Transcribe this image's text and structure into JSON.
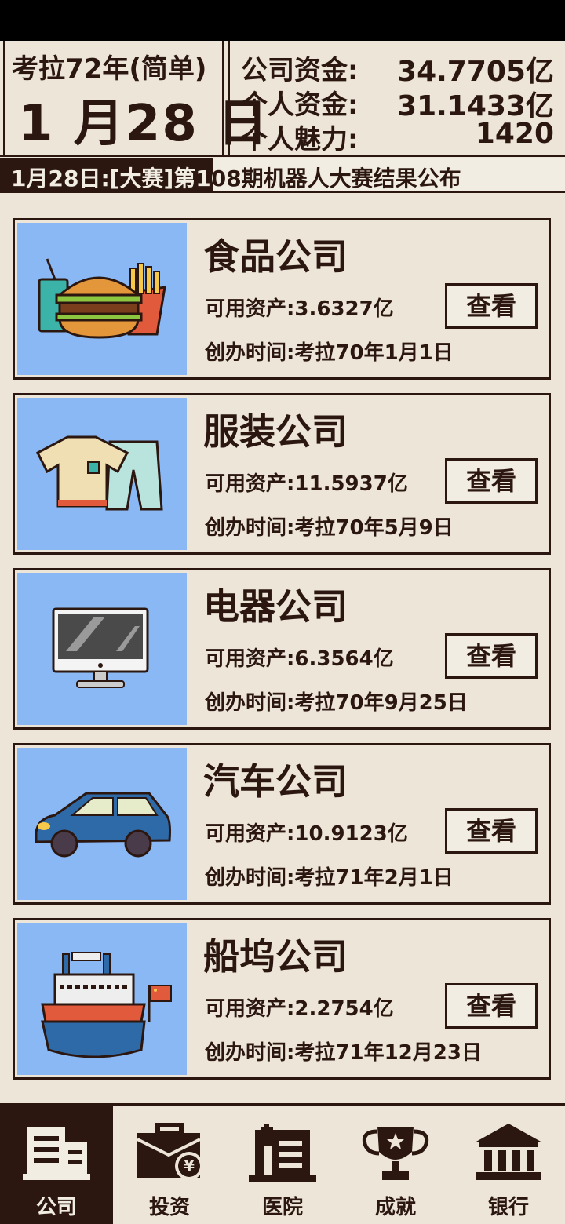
{
  "header": {
    "year": "考拉72年(简单)",
    "date": "1 月28 日",
    "funds": [
      {
        "label": "公司资金:",
        "value": "34.7705亿"
      },
      {
        "label": "个人资金:",
        "value": "31.1433亿"
      },
      {
        "label": "个人魅力:",
        "value": "1420"
      }
    ]
  },
  "news": {
    "text": "1月28日:[大赛]第108期机器人大赛结果公布"
  },
  "companies": [
    {
      "name": "食品公司",
      "assets": "可用资产:3.6327亿",
      "founded": "创办时间:考拉70年1月1日",
      "view": "查看",
      "icon": "food-icon"
    },
    {
      "name": "服装公司",
      "assets": "可用资产:11.5937亿",
      "founded": "创办时间:考拉70年5月9日",
      "view": "查看",
      "icon": "clothing-icon"
    },
    {
      "name": "电器公司",
      "assets": "可用资产:6.3564亿",
      "founded": "创办时间:考拉70年9月25日",
      "view": "查看",
      "icon": "monitor-icon"
    },
    {
      "name": "汽车公司",
      "assets": "可用资产:10.9123亿",
      "founded": "创办时间:考拉71年2月1日",
      "view": "查看",
      "icon": "car-icon"
    },
    {
      "name": "船坞公司",
      "assets": "可用资产:2.2754亿",
      "founded": "创办时间:考拉71年12月23日",
      "view": "查看",
      "icon": "ship-icon"
    }
  ],
  "nav": [
    {
      "label": "公司",
      "icon": "building-icon",
      "active": true
    },
    {
      "label": "投资",
      "icon": "briefcase-yen-icon",
      "active": false
    },
    {
      "label": "医院",
      "icon": "hospital-icon",
      "active": false
    },
    {
      "label": "成就",
      "icon": "trophy-icon",
      "active": false
    },
    {
      "label": "银行",
      "icon": "bank-icon",
      "active": false
    }
  ],
  "colors": {
    "dark": "#2b1710",
    "paper": "#ede6d8",
    "image_bg": "#8ab8f5"
  }
}
